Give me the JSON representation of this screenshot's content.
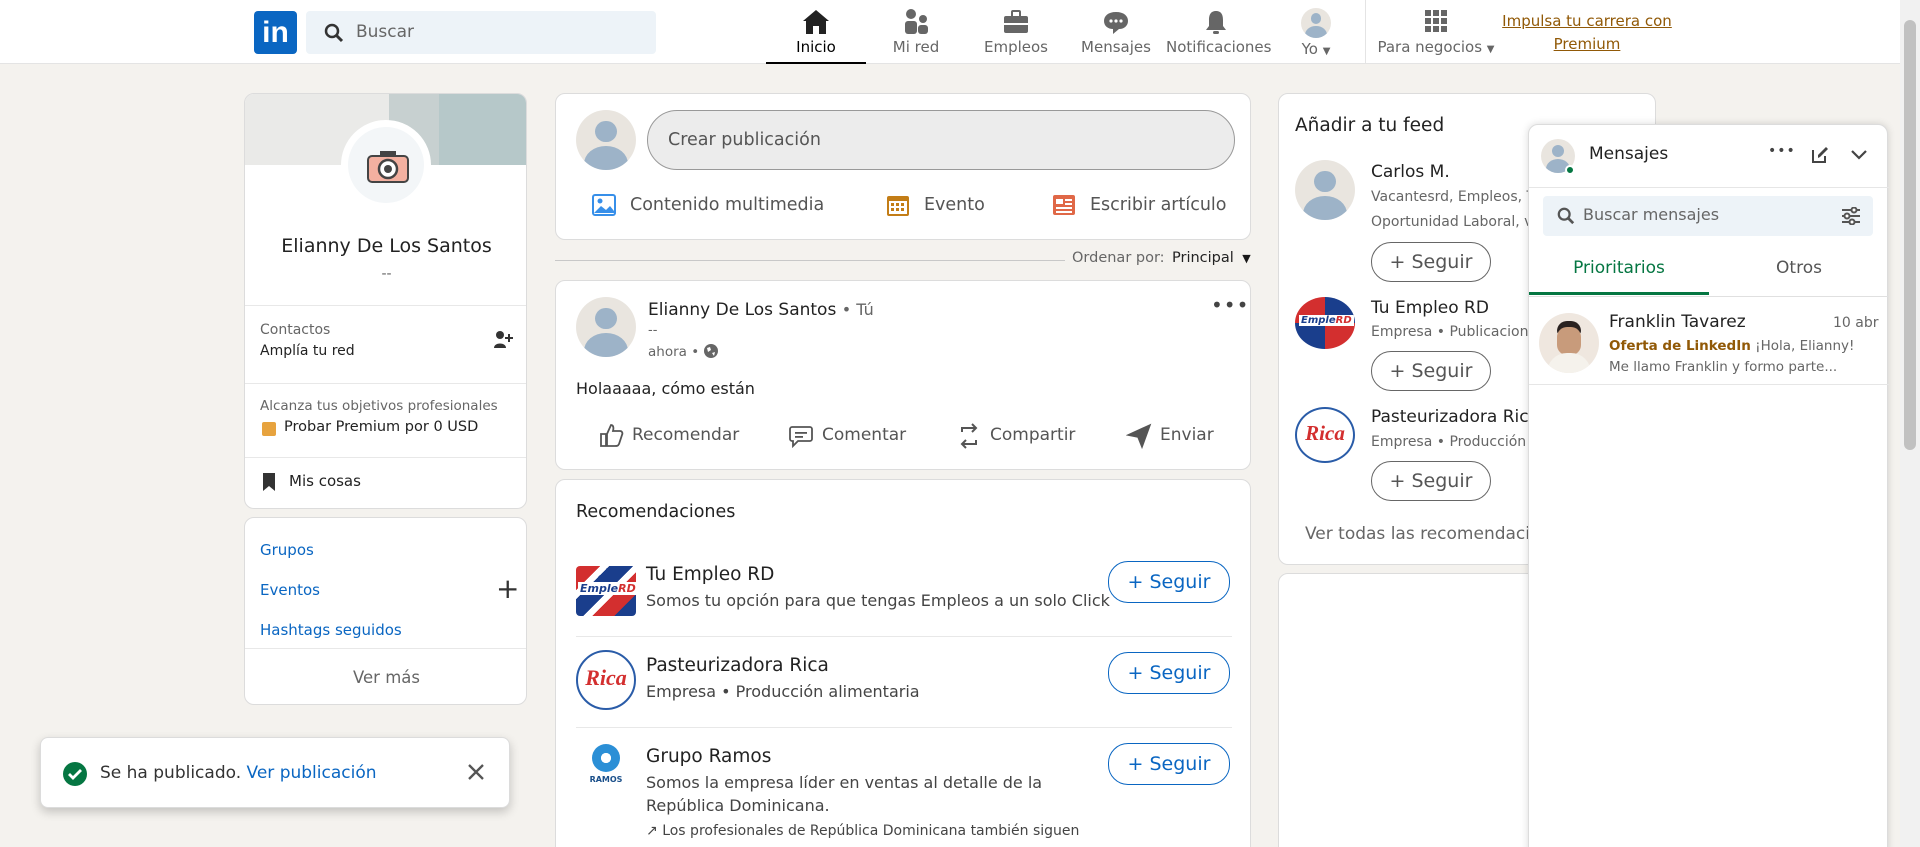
{
  "nav": {
    "logo": "in",
    "search_placeholder": "Buscar",
    "items": [
      "Inicio",
      "Mi red",
      "Empleos",
      "Mensajes",
      "Notificaciones",
      "Yo",
      "Para negocios"
    ],
    "premium_line1": "Impulsa tu carrera con",
    "premium_line2": "Premium"
  },
  "profile": {
    "name": "Elianny De Los Santos",
    "headline": "--",
    "contacts_label": "Contactos",
    "contacts_sub": "Amplía tu red",
    "premium_prompt": "Alcanza tus objetivos profesionales",
    "premium_cta": "Probar Premium por 0 USD",
    "saved": "Mis cosas"
  },
  "shortcuts": {
    "groups": "Grupos",
    "events": "Eventos",
    "hashtags": "Hashtags seguidos",
    "more": "Ver más"
  },
  "composer": {
    "placeholder": "Crear publicación",
    "media": "Contenido multimedia",
    "event": "Evento",
    "article": "Escribir artículo"
  },
  "sort": {
    "label": "Ordenar por:",
    "value": "Principal"
  },
  "post": {
    "author": "Elianny De Los Santos",
    "you": "• Tú",
    "headline": "--",
    "time": "ahora •",
    "text": "Holaaaaa, cómo están",
    "actions": [
      "Recomendar",
      "Comentar",
      "Compartir",
      "Enviar"
    ]
  },
  "recommendations": {
    "title": "Recomendaciones",
    "follow": "Seguir",
    "items": [
      {
        "name": "Tu Empleo RD",
        "desc": "Somos tu opción para que tengas Empleos a un solo Click"
      },
      {
        "name": "Pasteurizadora Rica",
        "desc": "Empresa • Producción alimentaria"
      },
      {
        "name": "Grupo Ramos",
        "desc": "Somos la empresa líder en ventas al detalle de la",
        "desc2": "República Dominicana.",
        "note": "Los profesionales de República Dominicana también siguen"
      }
    ]
  },
  "feed": {
    "title": "Añadir a tu feed",
    "follow": "Seguir",
    "items": [
      {
        "name": "Carlos M.",
        "sub1": "Vacantesrd, Empleos, Tra",
        "sub2": "Oportunidad Laboral, va"
      },
      {
        "name": "Tu Empleo RD",
        "sub1": "Empresa • Publicaciones"
      },
      {
        "name": "Pasteurizadora Rica",
        "sub1": "Empresa • Producción al"
      }
    ],
    "view_all": "Ver todas las recomendacion"
  },
  "messaging": {
    "title": "Mensajes",
    "search_placeholder": "Buscar mensajes",
    "tabs": [
      "Prioritarios",
      "Otros"
    ],
    "conversation": {
      "name": "Franklin Tavarez",
      "date": "10 abr",
      "source": "Oferta de LinkedIn",
      "preview1": "¡Hola, Elianny!",
      "preview2": "Me llamo Franklin y formo parte..."
    }
  },
  "toast": {
    "text": "Se ha publicado.",
    "link": "Ver publicación"
  },
  "colors": {
    "brand": "#0a66c2",
    "green": "#057642",
    "premium": "#915907"
  }
}
